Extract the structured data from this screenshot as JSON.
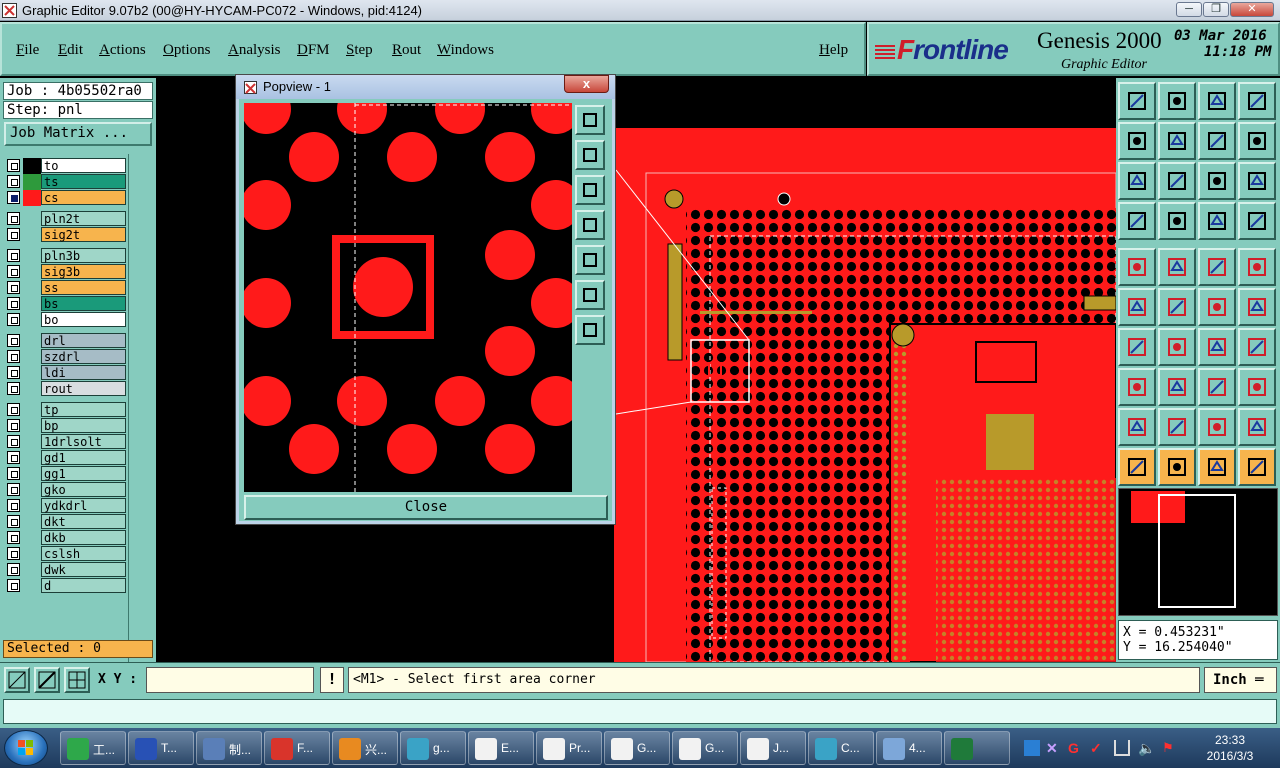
{
  "window": {
    "title": "Graphic Editor 9.07b2 (00@HY-HYCAM-PC072 - Windows, pid:4124)",
    "min_icon": "minimize-icon",
    "max_icon": "maximize-icon",
    "close_icon": "close-icon"
  },
  "menu": {
    "items": [
      "File",
      "Edit",
      "Actions",
      "Options",
      "Analysis",
      "DFM",
      "Step",
      "Rout",
      "Windows"
    ],
    "help": "Help"
  },
  "brand": {
    "logo_prefix": "F",
    "logo_rest": "rontline",
    "product": "Genesis 2000",
    "subtitle": "Graphic Editor",
    "date": "03 Mar 2016",
    "time": "11:18 PM"
  },
  "left": {
    "job": "Job : 4b05502ra0",
    "step": "Step: pnl",
    "job_matrix": "Job Matrix ...",
    "selected": "Selected : 0"
  },
  "layers": [
    {
      "name": "to",
      "swatch": "#000000",
      "bg": "#ffffff",
      "on": false
    },
    {
      "name": "ts",
      "swatch": "#2e9a3c",
      "bg": "#1a9a7a",
      "on": false
    },
    {
      "name": "cs",
      "swatch": "#ff1a1a",
      "bg": "#f7b44d",
      "on": true
    },
    {
      "name": "pln2t",
      "swatch": "",
      "bg": "#9fd6c8",
      "on": false
    },
    {
      "name": "sig2t",
      "swatch": "",
      "bg": "#f7b44d",
      "on": false
    },
    {
      "name": "pln3b",
      "swatch": "",
      "bg": "#9fd6c8",
      "on": false
    },
    {
      "name": "sig3b",
      "swatch": "",
      "bg": "#f7b44d",
      "on": false
    },
    {
      "name": "ss",
      "swatch": "",
      "bg": "#f7b44d",
      "on": false
    },
    {
      "name": "bs",
      "swatch": "",
      "bg": "#1a9a7a",
      "on": false
    },
    {
      "name": "bo",
      "swatch": "",
      "bg": "#ffffff",
      "on": false
    },
    {
      "name": "drl",
      "swatch": "",
      "bg": "#a6bcc6",
      "on": false
    },
    {
      "name": "szdrl",
      "swatch": "",
      "bg": "#a6bcc6",
      "on": false
    },
    {
      "name": "ldi",
      "swatch": "",
      "bg": "#a6bcc6",
      "on": false
    },
    {
      "name": "rout",
      "swatch": "",
      "bg": "#d8dde0",
      "on": false
    },
    {
      "name": "tp",
      "swatch": "",
      "bg": "#9fd6c8",
      "on": false
    },
    {
      "name": "bp",
      "swatch": "",
      "bg": "#9fd6c8",
      "on": false
    },
    {
      "name": "1drlsolt",
      "swatch": "",
      "bg": "#9fd6c8",
      "on": false
    },
    {
      "name": "gd1",
      "swatch": "",
      "bg": "#9fd6c8",
      "on": false
    },
    {
      "name": "gg1",
      "swatch": "",
      "bg": "#9fd6c8",
      "on": false
    },
    {
      "name": "gko",
      "swatch": "",
      "bg": "#9fd6c8",
      "on": false
    },
    {
      "name": "ydkdrl",
      "swatch": "",
      "bg": "#9fd6c8",
      "on": false
    },
    {
      "name": "dkt",
      "swatch": "",
      "bg": "#9fd6c8",
      "on": false
    },
    {
      "name": "dkb",
      "swatch": "",
      "bg": "#9fd6c8",
      "on": false
    },
    {
      "name": "cslsh",
      "swatch": "",
      "bg": "#9fd6c8",
      "on": false
    },
    {
      "name": "dwk",
      "swatch": "",
      "bg": "#9fd6c8",
      "on": false
    },
    {
      "name": "d",
      "swatch": "",
      "bg": "#9fd6c8",
      "on": false
    }
  ],
  "popview": {
    "title": "Popview - 1",
    "close_x": "x",
    "close": "Close",
    "tools": [
      "zoom-fit-icon",
      "pan-up-icon",
      "pan-down-icon",
      "pan-left-icon",
      "pan-right-icon",
      "zoom-out-icon",
      "zoom-in-icon"
    ]
  },
  "toolbox": {
    "icons": [
      "pan-up-icon",
      "pan-down-icon",
      "home-icon",
      "zoom-window-icon",
      "pan-left-icon",
      "pan-right-icon",
      "undo-zoom-icon",
      "redraw-icon",
      "zoom-out-icon",
      "zoom-in-icon",
      "scale-1-2-icon",
      "help-icon",
      "measure-icon",
      "grid-icon",
      "snap-icon",
      "snap-drill-icon",
      "select-icon",
      "clip-icon",
      "ruler-icon",
      "pad-icon",
      "connect-icon",
      "delete-icon",
      "move-icon",
      "copy-icon",
      "line-icon",
      "cut-line-icon",
      "arc-icon",
      "text-icon",
      "resize-icon",
      "break-icon",
      "centre-icon",
      "surface-icon",
      "triangle-icon",
      "polygon-icon",
      "outline-icon",
      "fill-icon",
      "pointer-icon",
      "pointer-sel-icon",
      "pointer-edit-icon",
      "route-icon"
    ]
  },
  "coords": {
    "x": "X = 0.453231\"",
    "y": "Y = 16.254040\""
  },
  "status": {
    "xy_label": "X Y :",
    "xy_value": "",
    "warn": "!",
    "prompt": "<M1> - Select first area corner",
    "units": "Inch ═"
  },
  "taskbar": {
    "items": [
      {
        "label": "工...",
        "color": "#2ea84a",
        "icon": "app-icon"
      },
      {
        "label": "T...",
        "color": "#2851b5",
        "icon": "save-icon"
      },
      {
        "label": "制...",
        "color": "#5a7fb8",
        "icon": "document-icon"
      },
      {
        "label": "F...",
        "color": "#d9342b",
        "icon": "app-icon"
      },
      {
        "label": "兴...",
        "color": "#e88a20",
        "icon": "shell-icon"
      },
      {
        "label": "g...",
        "color": "#3aa3c6",
        "icon": "eye-icon"
      },
      {
        "label": "E...",
        "color": "#f2f2f2",
        "icon": "genesis-icon"
      },
      {
        "label": "Pr...",
        "color": "#f2f2f2",
        "icon": "genesis-icon"
      },
      {
        "label": "G...",
        "color": "#f2f2f2",
        "icon": "genesis-icon"
      },
      {
        "label": "G...",
        "color": "#f2f2f2",
        "icon": "genesis-icon"
      },
      {
        "label": "J...",
        "color": "#f2f2f2",
        "icon": "genesis-icon"
      },
      {
        "label": "C...",
        "color": "#3aa3c6",
        "icon": "eye-icon"
      },
      {
        "label": "4...",
        "color": "#7da7d9",
        "icon": "document-icon"
      },
      {
        "label": "",
        "color": "#1f7a3a",
        "icon": "excel-icon"
      }
    ],
    "clock_time": "23:33",
    "clock_date": "2016/3/3"
  }
}
